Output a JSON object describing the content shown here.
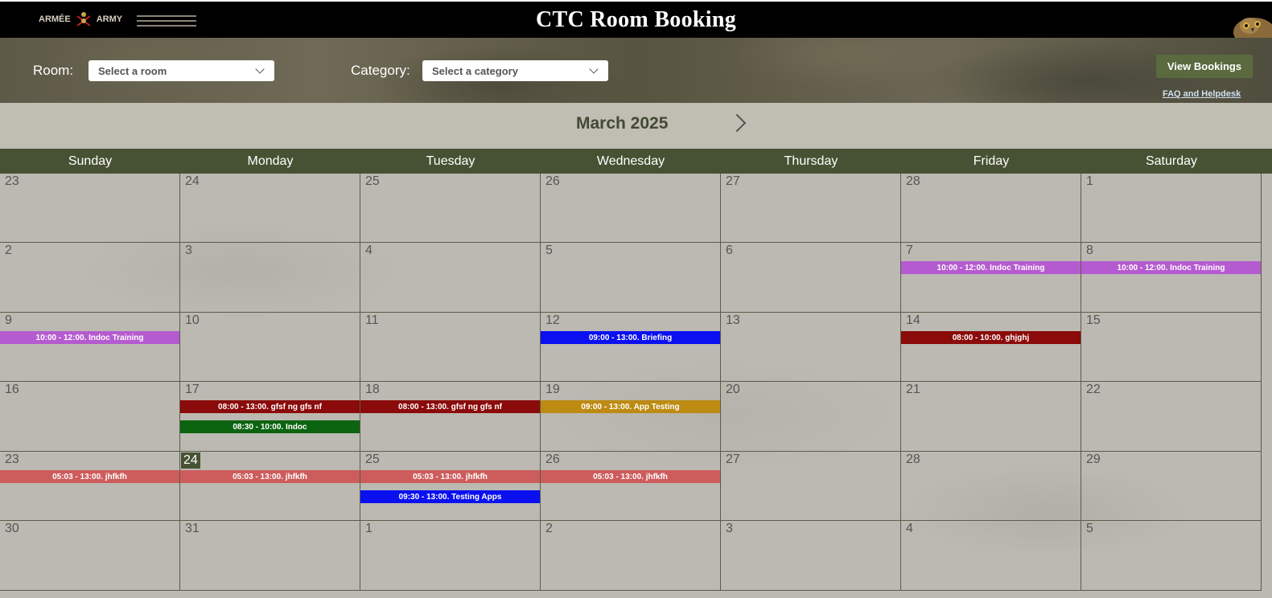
{
  "header": {
    "title": "CTC Room Booking",
    "logo_left_fr": "ARMÉE",
    "logo_left_en": "ARMY"
  },
  "filters": {
    "room_label": "Room:",
    "room_placeholder": "Select a room",
    "category_label": "Category:",
    "category_placeholder": "Select a category",
    "view_bookings": "View Bookings",
    "faq": "FAQ and Helpdesk"
  },
  "calendar": {
    "month": "March 2025",
    "weekdays": [
      "Sunday",
      "Monday",
      "Tuesday",
      "Wednesday",
      "Thursday",
      "Friday",
      "Saturday"
    ],
    "weeks": [
      [
        "23",
        "24",
        "25",
        "26",
        "27",
        "28",
        "1"
      ],
      [
        "2",
        "3",
        "4",
        "5",
        "6",
        "7",
        "8"
      ],
      [
        "9",
        "10",
        "11",
        "12",
        "13",
        "14",
        "15"
      ],
      [
        "16",
        "17",
        "18",
        "19",
        "20",
        "21",
        "22"
      ],
      [
        "23",
        "24",
        "25",
        "26",
        "27",
        "28",
        "29"
      ],
      [
        "30",
        "31",
        "1",
        "2",
        "3",
        "4",
        "5"
      ]
    ],
    "today": {
      "week": 4,
      "day": 1
    },
    "events": [
      {
        "week": 1,
        "day": 5,
        "slot": 0,
        "label": "10:00 - 12:00. Indoc Training",
        "color": "#b55bd0"
      },
      {
        "week": 1,
        "day": 6,
        "slot": 0,
        "label": "10:00 - 12:00. Indoc Training",
        "color": "#b55bd0"
      },
      {
        "week": 2,
        "day": 0,
        "slot": 0,
        "label": "10:00 - 12:00. Indoc Training",
        "color": "#b55bd0"
      },
      {
        "week": 2,
        "day": 3,
        "slot": 0,
        "label": "09:00 - 13:00. Briefing",
        "color": "#0a10f0"
      },
      {
        "week": 2,
        "day": 5,
        "slot": 0,
        "label": "08:00 - 10:00. ghjghj",
        "color": "#8b0a0a"
      },
      {
        "week": 3,
        "day": 1,
        "slot": 0,
        "label": "08:00 - 13:00. gfsf ng gfs nf",
        "color": "#8b0a0a"
      },
      {
        "week": 3,
        "day": 1,
        "slot": 1,
        "label": "08:30 - 10:00. Indoc",
        "color": "#0c6410"
      },
      {
        "week": 3,
        "day": 2,
        "slot": 0,
        "label": "08:00 - 13:00. gfsf ng gfs nf",
        "color": "#8b0a0a"
      },
      {
        "week": 3,
        "day": 3,
        "slot": 0,
        "label": "09:00 - 13:00. App Testing",
        "color": "#bd8a12"
      },
      {
        "week": 4,
        "day": 0,
        "slot": 0,
        "label": "05:03 - 13:00. jhfkfh",
        "color": "#cd5c5c"
      },
      {
        "week": 4,
        "day": 1,
        "slot": 0,
        "label": "05:03 - 13:00. jhfkfh",
        "color": "#cd5c5c"
      },
      {
        "week": 4,
        "day": 2,
        "slot": 0,
        "label": "05:03 - 13:00. jhfkfh",
        "color": "#cd5c5c"
      },
      {
        "week": 4,
        "day": 2,
        "slot": 1,
        "label": "09:30 - 13:00. Testing Apps",
        "color": "#0a10f0"
      },
      {
        "week": 4,
        "day": 3,
        "slot": 0,
        "label": "05:03 - 13:00. jhfkfh",
        "color": "#cd5c5c"
      }
    ]
  },
  "icons": {
    "room_dropdown": "chevron-down-icon",
    "category_dropdown": "chevron-down-icon",
    "next_month": "chevron-right-icon"
  }
}
